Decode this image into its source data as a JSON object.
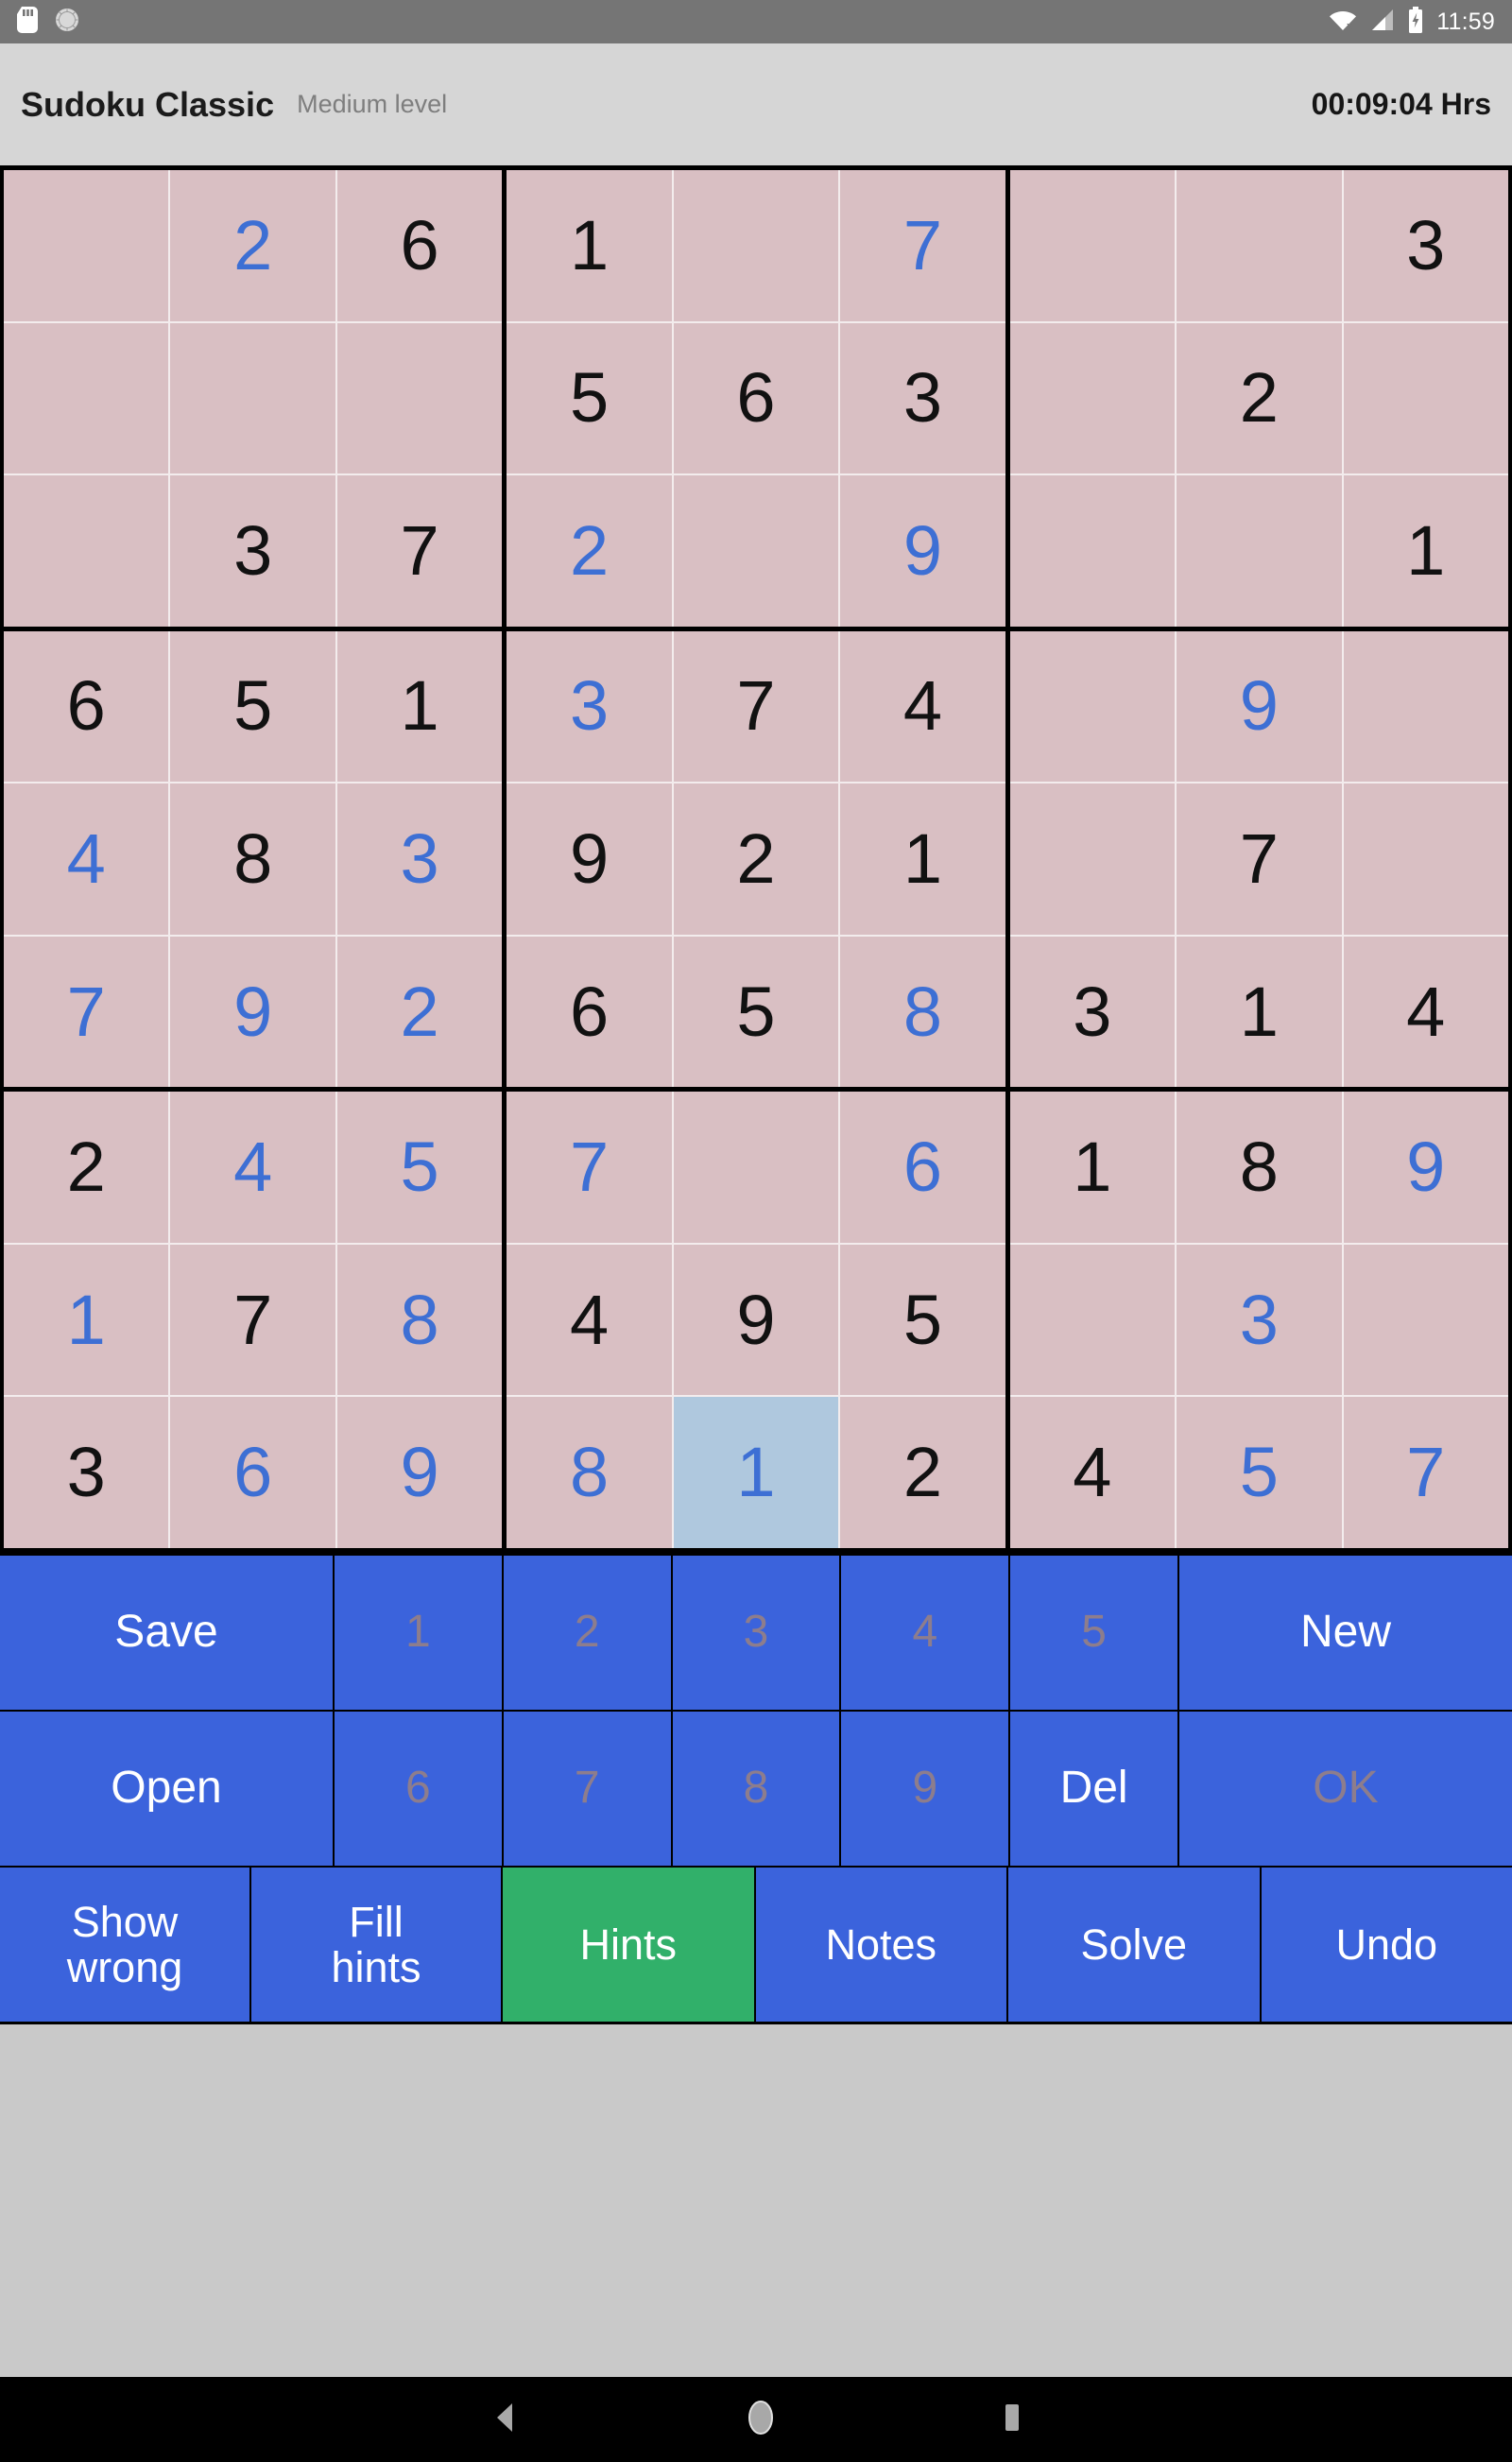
{
  "status_bar": {
    "left_icons": [
      "sd-card-icon",
      "brightness-icon"
    ],
    "right_icons": [
      "wifi-off-icon",
      "cellular-signal-icon",
      "battery-charging-icon"
    ],
    "time": "11:59"
  },
  "app_bar": {
    "title": "Sudoku Classic",
    "level": "Medium level",
    "timer": "00:09:04 Hrs"
  },
  "colors": {
    "cell_bg": "#d9bfc3",
    "cell_selected_bg": "#afc8de",
    "given_digit": "#111111",
    "user_digit": "#3d6fd4",
    "key_bg": "#3b63dc",
    "key_active_bg": "#31b06a",
    "key_disabled_text": "#8d7d8d",
    "board_line": "#000000"
  },
  "board": {
    "selected_cell": {
      "row": 9,
      "col": 5
    },
    "rows": [
      [
        {
          "v": "",
          "t": "empty"
        },
        {
          "v": "2",
          "t": "user"
        },
        {
          "v": "6",
          "t": "given"
        },
        {
          "v": "1",
          "t": "given"
        },
        {
          "v": "",
          "t": "empty"
        },
        {
          "v": "7",
          "t": "user"
        },
        {
          "v": "",
          "t": "empty"
        },
        {
          "v": "",
          "t": "empty"
        },
        {
          "v": "3",
          "t": "given"
        }
      ],
      [
        {
          "v": "",
          "t": "empty"
        },
        {
          "v": "",
          "t": "empty"
        },
        {
          "v": "",
          "t": "empty"
        },
        {
          "v": "5",
          "t": "given"
        },
        {
          "v": "6",
          "t": "given"
        },
        {
          "v": "3",
          "t": "given"
        },
        {
          "v": "",
          "t": "empty"
        },
        {
          "v": "2",
          "t": "given"
        },
        {
          "v": "",
          "t": "empty"
        }
      ],
      [
        {
          "v": "",
          "t": "empty"
        },
        {
          "v": "3",
          "t": "given"
        },
        {
          "v": "7",
          "t": "given"
        },
        {
          "v": "2",
          "t": "user"
        },
        {
          "v": "",
          "t": "empty"
        },
        {
          "v": "9",
          "t": "user"
        },
        {
          "v": "",
          "t": "empty"
        },
        {
          "v": "",
          "t": "empty"
        },
        {
          "v": "1",
          "t": "given"
        }
      ],
      [
        {
          "v": "6",
          "t": "given"
        },
        {
          "v": "5",
          "t": "given"
        },
        {
          "v": "1",
          "t": "given"
        },
        {
          "v": "3",
          "t": "user"
        },
        {
          "v": "7",
          "t": "given"
        },
        {
          "v": "4",
          "t": "given"
        },
        {
          "v": "",
          "t": "empty"
        },
        {
          "v": "9",
          "t": "user"
        },
        {
          "v": "",
          "t": "empty"
        }
      ],
      [
        {
          "v": "4",
          "t": "user"
        },
        {
          "v": "8",
          "t": "given"
        },
        {
          "v": "3",
          "t": "user"
        },
        {
          "v": "9",
          "t": "given"
        },
        {
          "v": "2",
          "t": "given"
        },
        {
          "v": "1",
          "t": "given"
        },
        {
          "v": "",
          "t": "empty"
        },
        {
          "v": "7",
          "t": "given"
        },
        {
          "v": "",
          "t": "empty"
        }
      ],
      [
        {
          "v": "7",
          "t": "user"
        },
        {
          "v": "9",
          "t": "user"
        },
        {
          "v": "2",
          "t": "user"
        },
        {
          "v": "6",
          "t": "given"
        },
        {
          "v": "5",
          "t": "given"
        },
        {
          "v": "8",
          "t": "user"
        },
        {
          "v": "3",
          "t": "given"
        },
        {
          "v": "1",
          "t": "given"
        },
        {
          "v": "4",
          "t": "given"
        }
      ],
      [
        {
          "v": "2",
          "t": "given"
        },
        {
          "v": "4",
          "t": "user"
        },
        {
          "v": "5",
          "t": "user"
        },
        {
          "v": "7",
          "t": "user"
        },
        {
          "v": "",
          "t": "empty"
        },
        {
          "v": "6",
          "t": "user"
        },
        {
          "v": "1",
          "t": "given"
        },
        {
          "v": "8",
          "t": "given"
        },
        {
          "v": "9",
          "t": "user"
        }
      ],
      [
        {
          "v": "1",
          "t": "user"
        },
        {
          "v": "7",
          "t": "given"
        },
        {
          "v": "8",
          "t": "user"
        },
        {
          "v": "4",
          "t": "given"
        },
        {
          "v": "9",
          "t": "given"
        },
        {
          "v": "5",
          "t": "given"
        },
        {
          "v": "",
          "t": "empty"
        },
        {
          "v": "3",
          "t": "user"
        },
        {
          "v": "",
          "t": "empty"
        }
      ],
      [
        {
          "v": "3",
          "t": "given"
        },
        {
          "v": "6",
          "t": "user"
        },
        {
          "v": "9",
          "t": "user"
        },
        {
          "v": "8",
          "t": "user"
        },
        {
          "v": "1",
          "t": "selected"
        },
        {
          "v": "2",
          "t": "given"
        },
        {
          "v": "4",
          "t": "given"
        },
        {
          "v": "5",
          "t": "user"
        },
        {
          "v": "7",
          "t": "user"
        }
      ]
    ]
  },
  "keypad": {
    "row1": [
      {
        "label": "Save",
        "state": "enabled",
        "kind": "wide"
      },
      {
        "label": "1",
        "state": "disabled",
        "kind": "num"
      },
      {
        "label": "2",
        "state": "disabled",
        "kind": "num"
      },
      {
        "label": "3",
        "state": "disabled",
        "kind": "num"
      },
      {
        "label": "4",
        "state": "disabled",
        "kind": "num"
      },
      {
        "label": "5",
        "state": "disabled",
        "kind": "num"
      },
      {
        "label": "New",
        "state": "enabled",
        "kind": "wide"
      }
    ],
    "row2": [
      {
        "label": "Open",
        "state": "enabled",
        "kind": "wide"
      },
      {
        "label": "6",
        "state": "disabled",
        "kind": "num"
      },
      {
        "label": "7",
        "state": "disabled",
        "kind": "num"
      },
      {
        "label": "8",
        "state": "disabled",
        "kind": "num"
      },
      {
        "label": "9",
        "state": "disabled",
        "kind": "num"
      },
      {
        "label": "Del",
        "state": "enabled",
        "kind": "num"
      },
      {
        "label": "OK",
        "state": "disabled",
        "kind": "wide"
      }
    ],
    "row3": [
      {
        "label": "Show\nwrong",
        "state": "enabled",
        "active": false,
        "kind": "two"
      },
      {
        "label": "Fill\nhints",
        "state": "enabled",
        "active": false,
        "kind": "two"
      },
      {
        "label": "Hints",
        "state": "enabled",
        "active": true,
        "kind": "one"
      },
      {
        "label": "Notes",
        "state": "enabled",
        "active": false,
        "kind": "one"
      },
      {
        "label": "Solve",
        "state": "enabled",
        "active": false,
        "kind": "one"
      },
      {
        "label": "Undo",
        "state": "enabled",
        "active": false,
        "kind": "one"
      }
    ]
  },
  "nav_bar": {
    "buttons": [
      "back-icon",
      "home-icon",
      "recents-icon"
    ]
  }
}
